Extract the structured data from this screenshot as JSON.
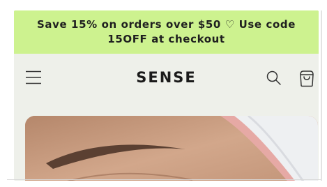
{
  "announcement": {
    "text": "Save 15% on orders over $50 ♡ Use code 15OFF at checkout"
  },
  "header": {
    "logo_text": "SENSE",
    "menu_icon": "hamburger-menu-icon",
    "search_icon": "search-icon",
    "cart_icon": "shopping-bag-icon"
  },
  "colors": {
    "announcement_bg": "#cdf28f",
    "page_bg": "#eef0ea",
    "text": "#1a1a1a"
  }
}
